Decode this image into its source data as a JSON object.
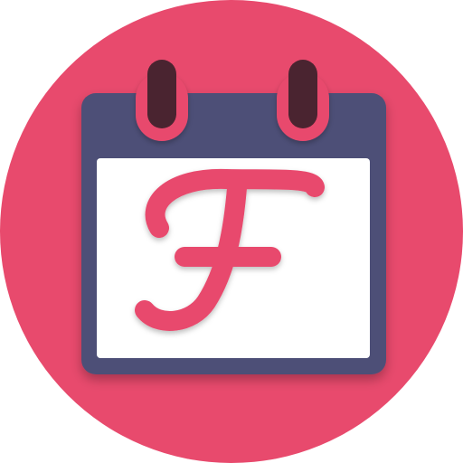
{
  "app_icon": {
    "letter": "F",
    "icon_name": "calendar-icon",
    "colors": {
      "background": "#e84a6d",
      "calendar_frame": "#4e5077",
      "page": "#ffffff",
      "ring": "#4a2430",
      "letter": "#e84a6d"
    }
  }
}
